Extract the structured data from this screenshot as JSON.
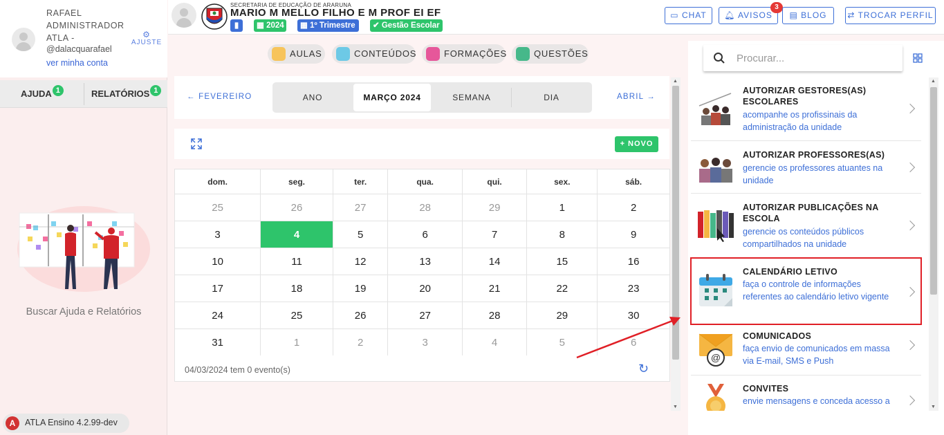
{
  "sidebar": {
    "user_name": "RAFAEL ADMINISTRADOR ATLA -",
    "user_handle": "@dalacquarafael",
    "account_link": "ver minha conta",
    "settings_label": "AJUSTE",
    "tabs": [
      {
        "label": "AJUDA",
        "count": "1"
      },
      {
        "label": "RELATÓRIOS",
        "count": "1"
      }
    ],
    "help_text": "Buscar Ajuda e Relatórios",
    "version": "ATLA Ensino 4.2.99-dev"
  },
  "header": {
    "secretaria": "SECRETARIA DE EDUCAÇÃO DE ARARUNA",
    "school": "MARIO M MELLO FILHO E M PROF EI EF",
    "chips": {
      "year": "2024",
      "term": "1º Trimestre",
      "module": "Gestão Escolar"
    },
    "buttons": {
      "chat": "CHAT",
      "avisos": "AVISOS",
      "avisos_count": "3",
      "blog": "BLOG",
      "trocar": "TROCAR PERFIL"
    }
  },
  "nav_pills": [
    "AULAS",
    "CONTEÚDOS",
    "FORMAÇÕES",
    "QUESTÕES"
  ],
  "calendar": {
    "prev": "← FEVEREIRO",
    "next": "ABRIL →",
    "views": [
      "ANO",
      "MARÇO 2024",
      "SEMANA",
      "DIA"
    ],
    "new_button": "+ NOVO",
    "weekdays": [
      "dom.",
      "seg.",
      "ter.",
      "qua.",
      "qui.",
      "sex.",
      "sáb."
    ],
    "weeks": [
      [
        "25",
        "26",
        "27",
        "28",
        "29",
        "1",
        "2"
      ],
      [
        "3",
        "4",
        "5",
        "6",
        "7",
        "8",
        "9"
      ],
      [
        "10",
        "11",
        "12",
        "13",
        "14",
        "15",
        "16"
      ],
      [
        "17",
        "18",
        "19",
        "20",
        "21",
        "22",
        "23"
      ],
      [
        "24",
        "25",
        "26",
        "27",
        "28",
        "29",
        "30"
      ],
      [
        "31",
        "1",
        "2",
        "3",
        "4",
        "5",
        "6"
      ]
    ],
    "footer": "04/03/2024 tem 0 evento(s)"
  },
  "panel": {
    "search_placeholder": "Procurar...",
    "cards": [
      {
        "title": "AUTORIZAR GESTORES(AS) ESCOLARES",
        "desc": "acompanhe os profissinais da administração da unidade"
      },
      {
        "title": "AUTORIZAR PROFESSORES(AS)",
        "desc": "gerencie os professores atuantes na unidade"
      },
      {
        "title": "AUTORIZAR PUBLICAÇÕES NA ESCOLA",
        "desc": "gerencie os conteúdos públicos compartilhados na unidade"
      },
      {
        "title": "CALENDÁRIO LETIVO",
        "desc": "faça o controle de informações referentes ao calendário letivo vigente"
      },
      {
        "title": "COMUNICADOS",
        "desc": "faça envio de comunicados em massa via E-mail, SMS e Push"
      },
      {
        "title": "CONVITES",
        "desc": "envie mensagens e conceda acesso a"
      }
    ]
  },
  "colors": {
    "accent": "#3d6fd7",
    "success": "#2ec46b",
    "highlight": "#e01f26"
  }
}
